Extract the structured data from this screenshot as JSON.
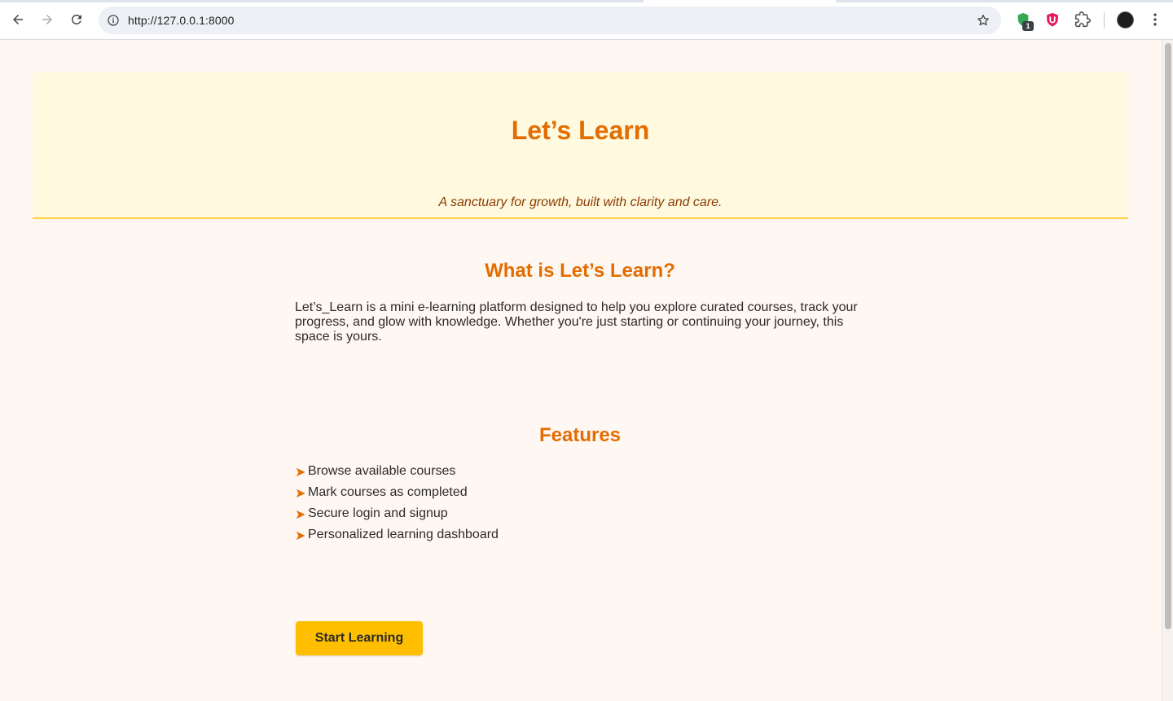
{
  "browser": {
    "url": "http://127.0.0.1:8000",
    "extension_badge": "1",
    "colors": {
      "omnibox_bg": "#edf0f5"
    }
  },
  "page": {
    "hero": {
      "title": "Let’s Learn",
      "tagline": "A sanctuary for growth, built with clarity and care."
    },
    "about": {
      "heading": "What is Let’s Learn?",
      "text": "Let’s_Learn is a mini e-learning platform designed to help you explore curated courses, track your progress, and glow with knowledge. Whether you're just starting or continuing your journey, this space is yours."
    },
    "features": {
      "heading": "Features",
      "bullet": "➤",
      "items": [
        {
          "label": "Browse available courses"
        },
        {
          "label": "Mark courses as completed"
        },
        {
          "label": "Secure login and signup"
        },
        {
          "label": "Personalized learning dashboard"
        }
      ]
    },
    "cta": {
      "label": "Start Learning"
    },
    "colors": {
      "accent": "#e36d00",
      "hero_bg": "#fff9e0",
      "hero_border": "#ffd23f",
      "button_bg": "#ffbf00",
      "page_bg": "#fff7f2"
    }
  }
}
